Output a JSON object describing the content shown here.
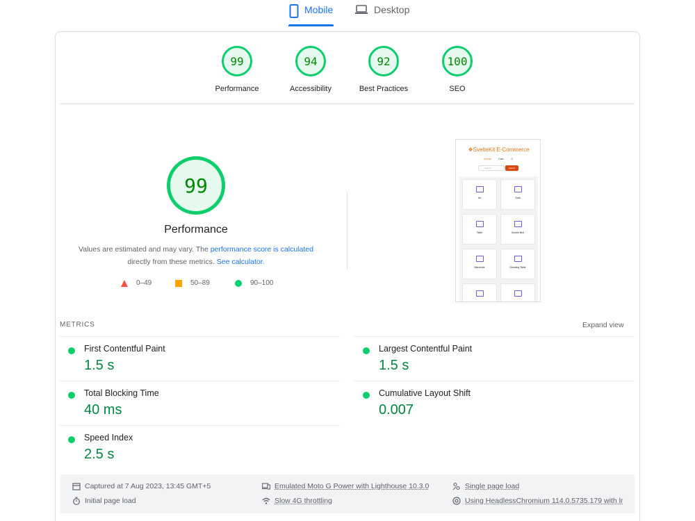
{
  "tabs": {
    "mobile": "Mobile",
    "desktop": "Desktop"
  },
  "scores": [
    {
      "value": "99",
      "label": "Performance"
    },
    {
      "value": "94",
      "label": "Accessibility"
    },
    {
      "value": "92",
      "label": "Best Practices"
    },
    {
      "value": "100",
      "label": "SEO"
    }
  ],
  "main": {
    "score": "99",
    "title": "Performance",
    "desc_1": "Values are estimated and may vary. The ",
    "desc_link_1": "performance score is calculated",
    "desc_2": "directly from these metrics. ",
    "desc_link_2": "See calculator."
  },
  "legend": {
    "fail": "0–49",
    "average": "50–89",
    "pass": "90–100"
  },
  "thumbnail": {
    "brand": "SvelteKit E-Commerce",
    "nav": [
      "Home",
      "Cart"
    ],
    "search_placeholder": "Search",
    "search_button": "Search",
    "tiles": [
      "Art",
      "Sofa",
      "Table",
      "Double Bed",
      "Wardrobe",
      "Dressing Table",
      "",
      ""
    ]
  },
  "metrics": {
    "title": "METRICS",
    "expand": "Expand view",
    "items": [
      {
        "name": "First Contentful Paint",
        "value": "1.5 s"
      },
      {
        "name": "Largest Contentful Paint",
        "value": "1.5 s"
      },
      {
        "name": "Total Blocking Time",
        "value": "40 ms"
      },
      {
        "name": "Cumulative Layout Shift",
        "value": "0.007"
      },
      {
        "name": "Speed Index",
        "value": "2.5 s"
      }
    ]
  },
  "footer": {
    "captured": "Captured at 7 Aug 2023, 13:45 GMT+5",
    "load": "Initial page load",
    "device": "Emulated Moto G Power with Lighthouse 10.3.0",
    "throttle": "Slow 4G throttling",
    "session": "Single page load",
    "browser": "Using HeadlessChromium 114.0.5735.179 with lr"
  },
  "colors": {
    "pass": "#0cce6b",
    "average": "#ffa400",
    "fail": "#ff4e42",
    "accent": "#1a73e8"
  }
}
